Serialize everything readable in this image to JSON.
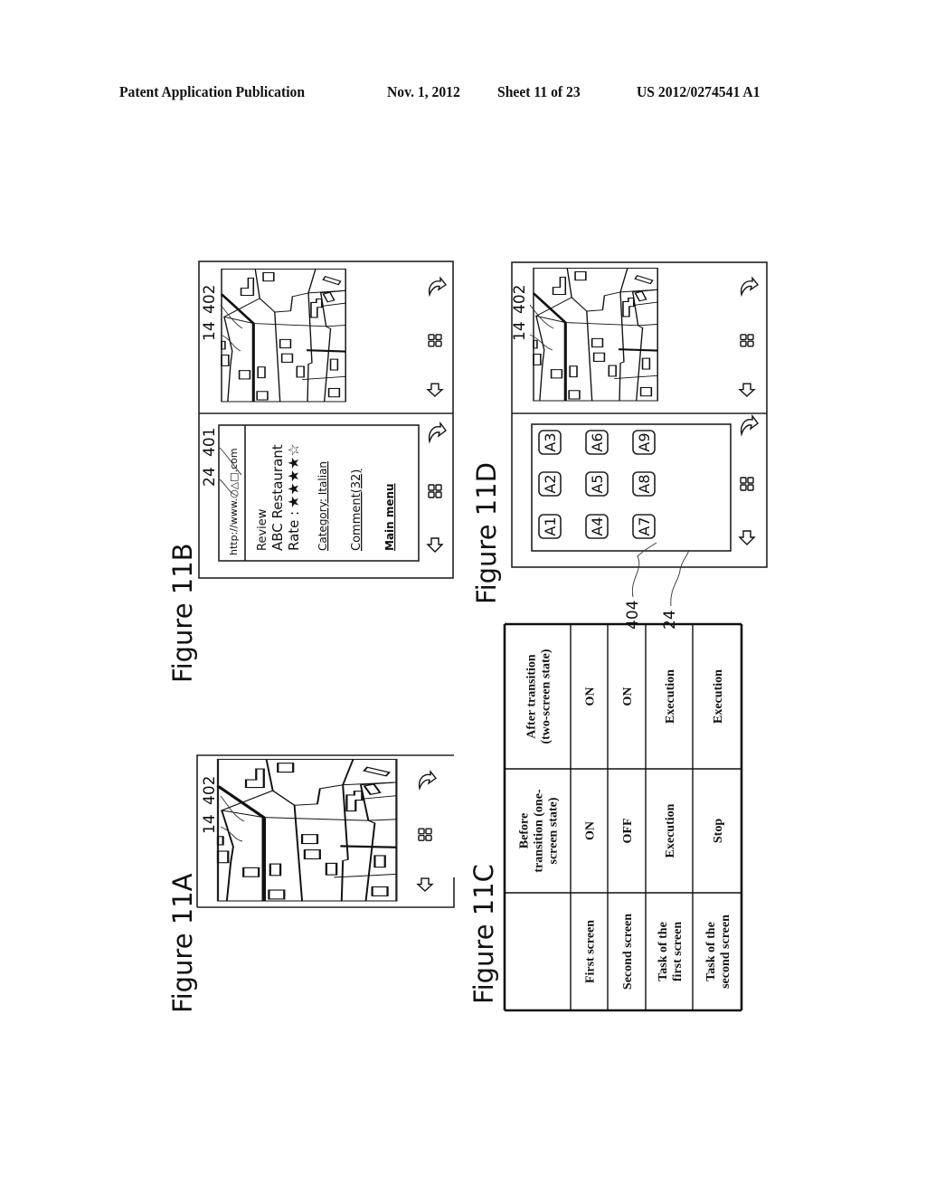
{
  "header": {
    "publication": "Patent Application Publication",
    "date": "Nov. 1, 2012",
    "sheet": "Sheet 11 of 23",
    "number": "US 2012/0274541 A1"
  },
  "figures": {
    "fig_11a": {
      "title": "Figure 11A",
      "ref_labels": [
        "14",
        "402"
      ]
    },
    "fig_11b": {
      "title": "Figure 11B",
      "ref_labels_top": [
        "24",
        "401"
      ],
      "ref_labels_map": [
        "14",
        "402"
      ],
      "browser": {
        "url": "http://www.○△□.com",
        "heading": "Review",
        "name": "ABC  Restaurant",
        "rate_label": "Rate :",
        "rating_stars": 4,
        "rating_max": 5,
        "stars_text": "★★★★☆",
        "category_link": "Category: Italian",
        "comment_link": "Comment(32)",
        "main_menu_link": "Main menu"
      }
    },
    "fig_11c": {
      "title": "Figure 11C",
      "table": {
        "columns": [
          "",
          "Before transition (one-screen state)",
          "After transition (two-screen state)"
        ],
        "column_lines": [
          [
            "",
            ""
          ],
          [
            "Before",
            "transition (one-",
            "screen state)"
          ],
          [
            "After transition",
            "(two-screen state)"
          ]
        ],
        "rows": [
          {
            "label": [
              "First screen"
            ],
            "before": "ON",
            "after": "ON"
          },
          {
            "label": [
              "Second screen"
            ],
            "before": "OFF",
            "after": "ON"
          },
          {
            "label": [
              "Task of the",
              "first screen"
            ],
            "before": "Execution",
            "after": "Execution"
          },
          {
            "label": [
              "Task of the",
              "second screen"
            ],
            "before": "Stop",
            "after": "Execution"
          }
        ]
      }
    },
    "fig_11d": {
      "title": "Figure 11D",
      "ref_labels_map": [
        "14",
        "402"
      ],
      "ref_labels_bottom": [
        "404",
        "24"
      ],
      "app_icons": [
        "A1",
        "A2",
        "A3",
        "A4",
        "A5",
        "A6",
        "A7",
        "A8",
        "A9"
      ]
    }
  },
  "nav_icons": [
    "back-arrow-icon",
    "home-grid-icon",
    "return-curved-arrow-icon"
  ]
}
